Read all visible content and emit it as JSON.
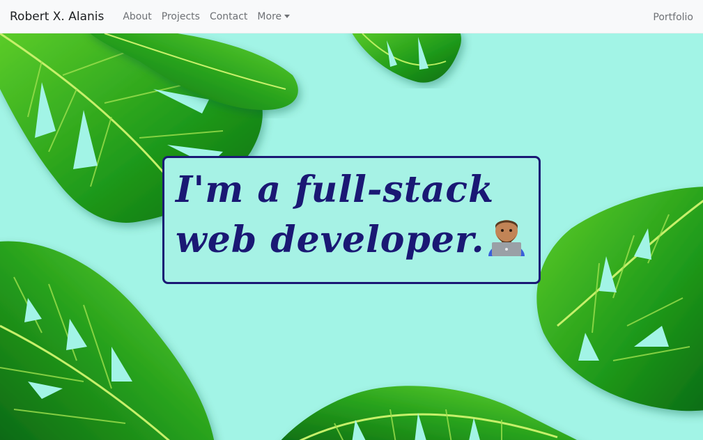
{
  "navbar": {
    "brand": "Robert X. Alanis",
    "links": [
      {
        "label": "About"
      },
      {
        "label": "Projects"
      },
      {
        "label": "Contact"
      },
      {
        "label": "More"
      }
    ],
    "right_link": "Portfolio"
  },
  "hero": {
    "line1": "I'm a full-stack",
    "line2": "web developer.",
    "emoji": "technologist-icon",
    "background_color": "#a2f4e6",
    "text_color": "#1a1874"
  }
}
